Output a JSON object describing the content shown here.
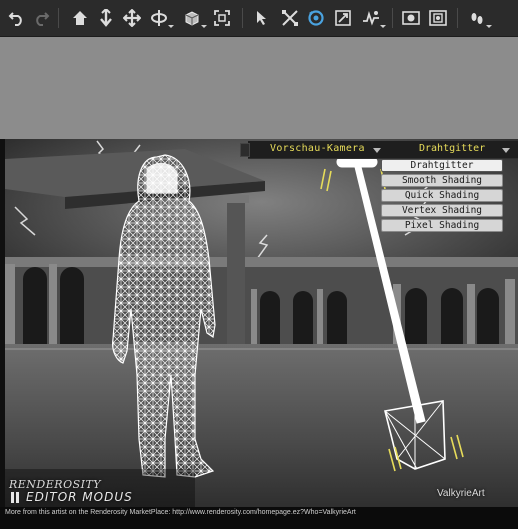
{
  "toolbar": {
    "buttons": [
      {
        "name": "undo-button",
        "icon": "undo-icon"
      },
      {
        "name": "redo-button",
        "icon": "redo-icon"
      },
      {
        "name": "home-button",
        "icon": "home-icon"
      },
      {
        "name": "move-vertical-button",
        "icon": "arrow-down-icon"
      },
      {
        "name": "move-button",
        "icon": "move-cross-icon"
      },
      {
        "name": "rotate-button",
        "icon": "rotate-icon"
      },
      {
        "name": "scale-box-button",
        "icon": "cube-icon"
      },
      {
        "name": "frame-button",
        "icon": "frame-icon"
      },
      {
        "name": "select-tool-button",
        "icon": "cursor-icon"
      },
      {
        "name": "transform-tool-button",
        "icon": "transform-icon"
      },
      {
        "name": "orbit-tool-button",
        "icon": "orbit-icon"
      },
      {
        "name": "zoom-tool-button",
        "icon": "zoom-box-icon"
      },
      {
        "name": "figure-tool-button",
        "icon": "figure-pose-icon"
      },
      {
        "name": "render-button",
        "icon": "camera-render-icon"
      },
      {
        "name": "area-render-button",
        "icon": "area-render-icon"
      },
      {
        "name": "footprints-button",
        "icon": "footprints-icon"
      }
    ]
  },
  "viewport": {
    "camera_label": "Vorschau-Kamera",
    "shading_label": "Drahtgitter",
    "shading_options": [
      "Drahtgitter",
      "Smooth Shading",
      "Quick Shading",
      "Vertex Shading",
      "Pixel Shading"
    ],
    "selected_shading": "Drahtgitter",
    "logo_text": "RENDEROSITY",
    "mode_text": "EDITOR MODUS",
    "artist_watermark": "ValkyrieArt",
    "credit_line": "More from this artist on the Renderosity MarketPlace: http://www.renderosity.com/homepage.ez?Who=ValkyrieArt"
  },
  "colors": {
    "toolbar_bg": "#2b2b2b",
    "label_yellow": "#e7dc5a",
    "active_icon": "#4aa3e0",
    "gray_area": "#8c8c8c"
  }
}
